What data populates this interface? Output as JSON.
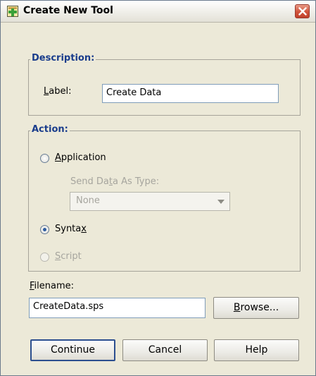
{
  "window": {
    "title": "Create New Tool"
  },
  "description": {
    "legend": "Description:",
    "label_prefix": "L",
    "label_rest": "abel:",
    "label_value": "Create Data"
  },
  "action": {
    "legend": "Action:",
    "application_prefix": "A",
    "application_rest": "pplication",
    "send_type_label_a": "Send Da",
    "send_type_label_b": "t",
    "send_type_label_c": "a As Type:",
    "send_type_value": "None",
    "syntax_a": "Synta",
    "syntax_b": "x",
    "script_prefix": "S",
    "script_rest": "cript",
    "selected": "Syntax"
  },
  "filename": {
    "label_prefix": "F",
    "label_rest": "ilename:",
    "value": "CreateData.sps",
    "browse_prefix": "B",
    "browse_rest": "rowse..."
  },
  "buttons": {
    "continue": "Continue",
    "cancel": "Cancel",
    "help": "Help"
  }
}
